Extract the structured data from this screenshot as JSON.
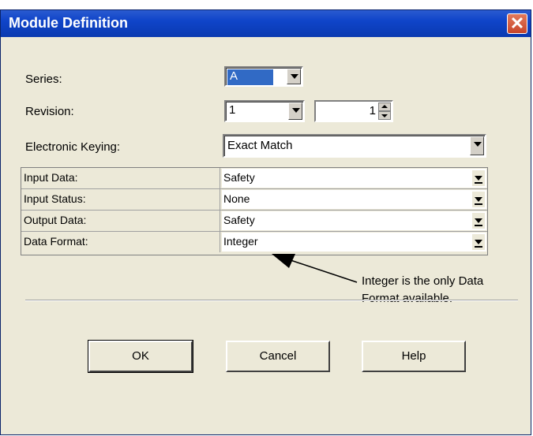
{
  "window": {
    "title": "Module Definition",
    "close_icon": "close-icon",
    "colors": {
      "titlebar": "#0f44c9",
      "body": "#ece9d8",
      "close": "#c8452a",
      "selection": "#316ac5"
    }
  },
  "form": {
    "series_label": "Series:",
    "series_value": "A",
    "revision_label": "Revision:",
    "revision_major": "1",
    "revision_minor": "1",
    "keying_label": "Electronic Keying:",
    "keying_value": "Exact Match"
  },
  "grid": {
    "rows": [
      {
        "label": "Input Data:",
        "value": "Safety"
      },
      {
        "label": "Input Status:",
        "value": "None"
      },
      {
        "label": "Output Data:",
        "value": "Safety"
      },
      {
        "label": "Data Format:",
        "value": "Integer"
      }
    ]
  },
  "annotation": {
    "line1": "Integer is the only Data",
    "line2": "Format available."
  },
  "buttons": {
    "ok": "OK",
    "cancel": "Cancel",
    "help": "Help"
  }
}
